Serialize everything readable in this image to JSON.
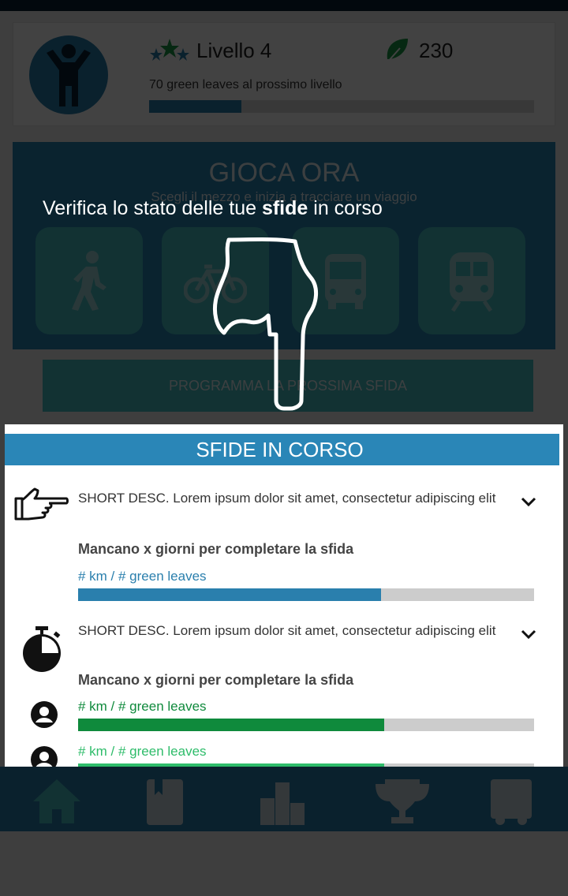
{
  "profile": {
    "level_label": "Livello 4",
    "leaves_count": "230",
    "next_level_text": "70 green leaves al prossimo livello",
    "level_progress": 0.24
  },
  "play": {
    "title": "GIOCA ORA",
    "subtitle": "Scegli il mezzo e inizia a tracciare un viaggio",
    "modes": [
      "walk-icon",
      "bike-icon",
      "bus-icon",
      "train-icon"
    ],
    "program_button": "PROGRAMMA LA PROSSIMA SFIDA"
  },
  "tutorial": {
    "text_before": "Verifica lo stato delle tue ",
    "text_bold": "sfide",
    "text_after": " in corso"
  },
  "challenges": {
    "header": "SFIDE IN CORSO",
    "items": [
      {
        "icon": "pointing-hand-icon",
        "description": "SHORT DESC. Lorem ipsum dolor sit amet, consectetur adipiscing elit",
        "remaining": "Mancano x giorni per completare la sfida",
        "stats": [
          {
            "label": "# km / # green leaves",
            "progress": 0.665,
            "color": "#2a7fad"
          }
        ]
      },
      {
        "icon": "stopwatch-icon",
        "description": "SHORT DESC. Lorem ipsum dolor sit amet, consectetur adipiscing elit",
        "remaining": "Mancano x giorni per completare la sfida",
        "stats": [
          {
            "label": "# km / # green leaves",
            "progress": 0.672,
            "color": "#0f8a3c"
          },
          {
            "label": "# km / # green leaves",
            "progress": 0.672,
            "color": "#2ebc6a"
          }
        ]
      }
    ]
  },
  "nav": [
    "home-icon",
    "diary-icon",
    "leaderboard-icon",
    "trophy-icon",
    "bus-double-decker-icon"
  ],
  "colors": {
    "primary": "#2a7fad",
    "accent": "#46c1c5",
    "leaf_green": "#1a9b46"
  }
}
